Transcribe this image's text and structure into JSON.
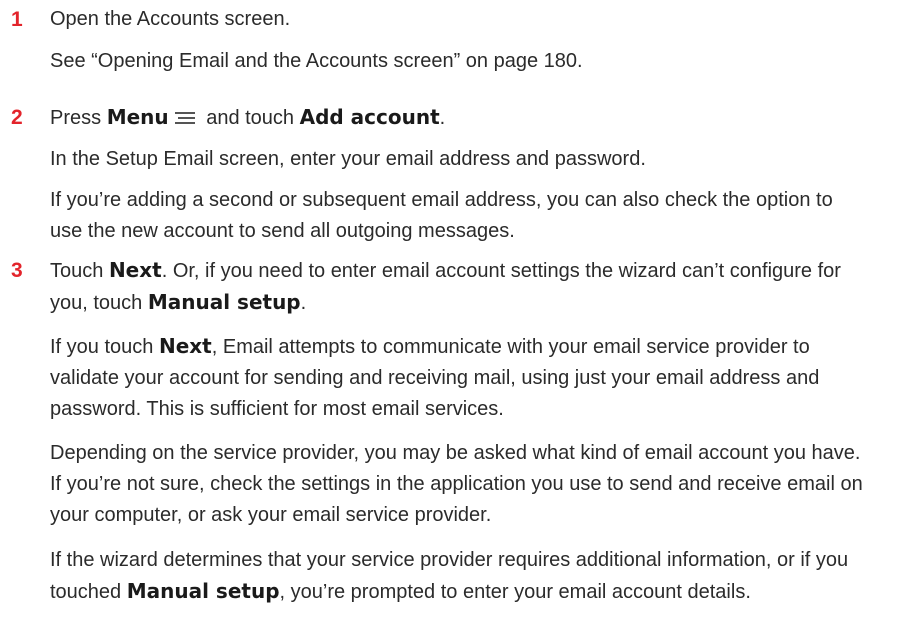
{
  "steps": [
    {
      "number": "1",
      "line": "Open the Accounts screen.",
      "para1": "See “Opening Email and the Accounts screen” on page 180."
    },
    {
      "number": "2",
      "pre": "Press ",
      "menu_label": "Menu",
      "mid": " and touch ",
      "add_label": "Add account",
      "post": ".",
      "para1": "In the Setup Email screen, enter your email address and password.",
      "para2": "If you’re adding a second or subsequent email address, you can also check the option to use the new account to send all outgoing messages."
    },
    {
      "number": "3",
      "pre": "Touch ",
      "next_label": "Next",
      "mid": ". Or, if you need to enter email account settings the wizard can’t configure for you, touch ",
      "manual_label": "Manual setup",
      "post": ".",
      "para1_pre": "If you touch ",
      "para1_next": "Next",
      "para1_post": ", Email attempts to communicate with your email service provider to validate your account for sending and receiving mail, using just your email address and password. This is sufficient for most email services.",
      "para2": "Depending on the service provider, you may be asked what kind of email account you have. If you’re not sure, check the settings in the application you use to send and receive email on your computer, or ask your email service provider.",
      "para3_pre": "If the wizard determines that your service provider requires additional information, or if you touched ",
      "para3_manual": "Manual setup",
      "para3_post": ", you’re prompted to enter your email account details."
    }
  ],
  "icons": {
    "menu": "menu-icon"
  },
  "colors": {
    "step_number": "#e3242b",
    "text": "#2b2b2b"
  }
}
